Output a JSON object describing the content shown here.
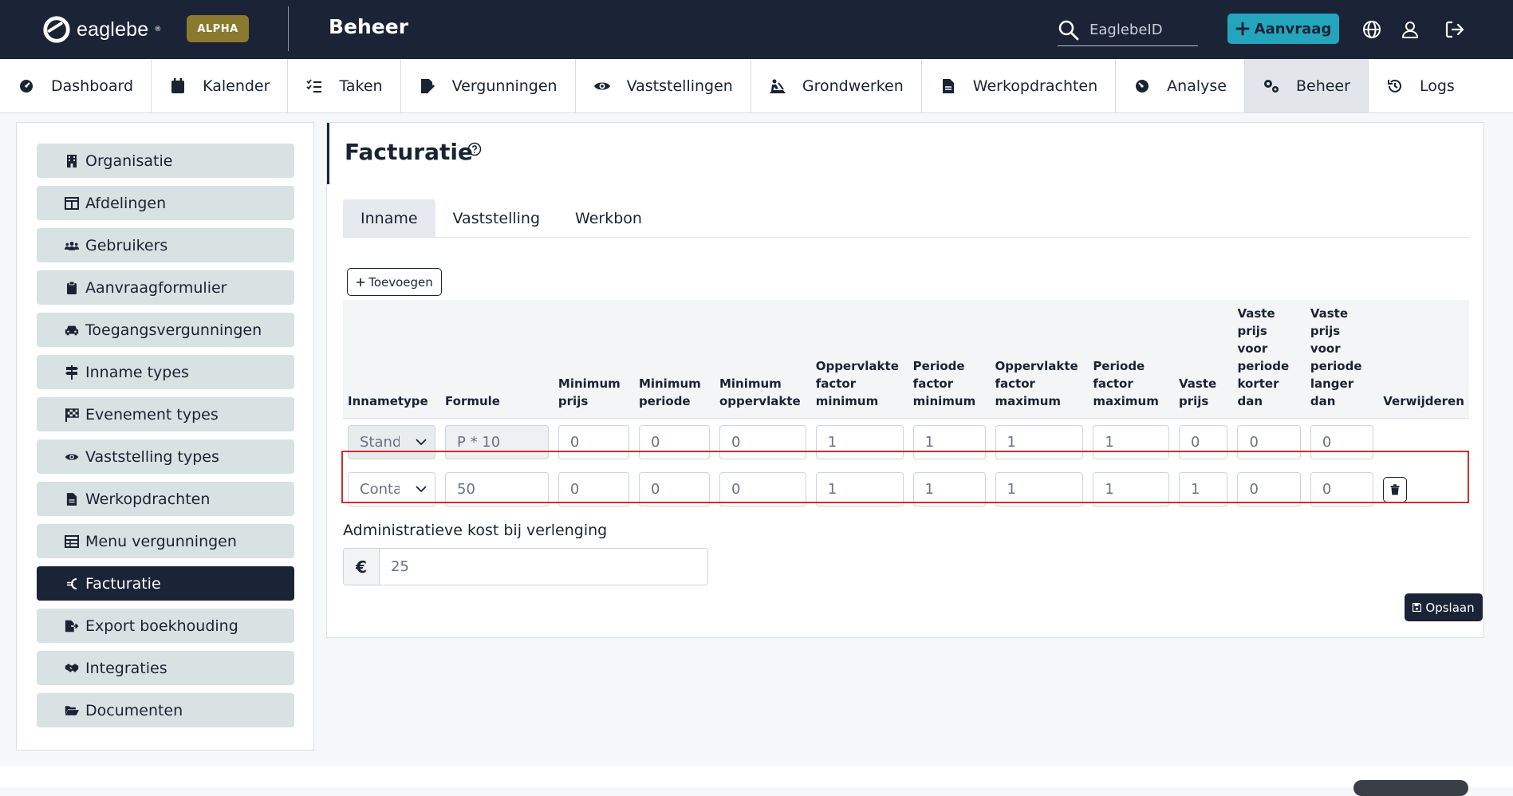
{
  "header": {
    "logo_text": "eaglebe",
    "logo_tm": "®",
    "badge": "ALPHA",
    "section_title": "Beheer",
    "search_placeholder": "EaglebeID",
    "aanvraag_label": "Aanvraag",
    "icons": [
      "globe-icon",
      "user-icon",
      "logout-icon"
    ]
  },
  "nav": {
    "items": [
      {
        "label": "Dashboard",
        "icon": "dashboard-icon"
      },
      {
        "label": "Kalender",
        "icon": "calendar-icon"
      },
      {
        "label": "Taken",
        "icon": "tasks-icon"
      },
      {
        "label": "Vergunningen",
        "icon": "permit-icon"
      },
      {
        "label": "Vaststellingen",
        "icon": "eye-icon"
      },
      {
        "label": "Grondwerken",
        "icon": "digging-icon"
      },
      {
        "label": "Werkopdrachten",
        "icon": "document-icon"
      },
      {
        "label": "Analyse",
        "icon": "gauge-icon"
      },
      {
        "label": "Beheer",
        "icon": "gears-icon"
      },
      {
        "label": "Logs",
        "icon": "history-icon"
      }
    ],
    "active": "Beheer"
  },
  "sidebar": {
    "items": [
      {
        "label": "Organisatie",
        "icon": "building-icon"
      },
      {
        "label": "Afdelingen",
        "icon": "table-columns-icon"
      },
      {
        "label": "Gebruikers",
        "icon": "users-icon"
      },
      {
        "label": "Aanvraagformulier",
        "icon": "clipboard-icon"
      },
      {
        "label": "Toegangsvergunningen",
        "icon": "car-icon"
      },
      {
        "label": "Inname types",
        "icon": "signs-icon"
      },
      {
        "label": "Evenement types",
        "icon": "checkered-flag-icon"
      },
      {
        "label": "Vaststelling types",
        "icon": "eye-icon"
      },
      {
        "label": "Werkopdrachten",
        "icon": "file-icon"
      },
      {
        "label": "Menu vergunningen",
        "icon": "table-icon"
      },
      {
        "label": "Facturatie",
        "icon": "euro-icon"
      },
      {
        "label": "Export boekhouding",
        "icon": "file-export-icon"
      },
      {
        "label": "Integraties",
        "icon": "handshake-icon"
      },
      {
        "label": "Documenten",
        "icon": "folder-open-icon"
      }
    ],
    "active": "Facturatie"
  },
  "main": {
    "title": "Facturatie",
    "tabs": [
      {
        "label": "Inname"
      },
      {
        "label": "Vaststelling"
      },
      {
        "label": "Werkbon"
      }
    ],
    "active_tab": "Inname",
    "add_label": "Toevoegen",
    "columns": [
      "Innametype",
      "Formule",
      "Minimum prijs",
      "Minimum periode",
      "Minimum oppervlakte",
      "Oppervlakte factor minimum",
      "Periode factor minimum",
      "Oppervlakte factor maximum",
      "Periode factor maximum",
      "Vaste prijs",
      "Vaste prijs voor periode korter dan",
      "Vaste prijs voor periode langer dan",
      "Verwijderen"
    ],
    "rows": [
      {
        "type": "Standaard",
        "formule": "P * 10",
        "values": [
          "0",
          "0",
          "0",
          "1",
          "1",
          "1",
          "1",
          "0",
          "0",
          "0"
        ],
        "deletable": false
      },
      {
        "type": "Container",
        "formule": "50",
        "values": [
          "0",
          "0",
          "0",
          "1",
          "1",
          "1",
          "1",
          "1",
          "0",
          "0"
        ],
        "deletable": true
      }
    ],
    "admin_label": "Administratieve kost bij verlenging",
    "admin_prefix": "€",
    "admin_value": "25",
    "save_label": "Opslaan"
  }
}
